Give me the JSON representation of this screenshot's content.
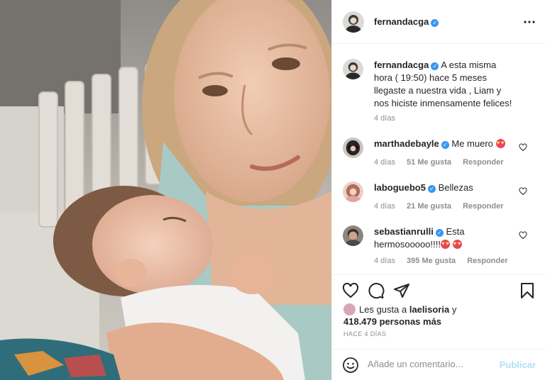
{
  "post": {
    "author": "fernandacga",
    "verified": true
  },
  "caption": {
    "username": "fernandacga",
    "text": "A esta misma hora ( 19:50) hace 5 meses llegaste a nuestra vida , Liam y nos hiciste inmensamente felices!",
    "time": "4 días"
  },
  "comments": [
    {
      "username": "marthadebayle",
      "verified": true,
      "text": "Me muero",
      "emoji": "heart-eyes-emoji",
      "time": "4 días",
      "likes": "51 Me gusta",
      "reply": "Responder"
    },
    {
      "username": "laboguebo5",
      "verified": true,
      "text": "Bellezas",
      "time": "4 días",
      "likes": "21 Me gusta",
      "reply": "Responder"
    },
    {
      "username": "sebastianrulli",
      "verified": true,
      "text": "Esta hermosooooo!!!!",
      "emoji": "heart-eyes-emoji",
      "time": "4 días",
      "likes": "395 Me gusta",
      "reply": "Responder"
    }
  ],
  "likes": {
    "prefix": "Les gusta a",
    "user": "laelisoria",
    "connector": "y",
    "count": "418.479 personas más"
  },
  "date": "HACE 4 DÍAS",
  "compose": {
    "placeholder": "Añade un comentario...",
    "post_label": "Publicar"
  },
  "icons": {
    "more": "more-options-icon",
    "like": "heart-icon",
    "comment": "comment-icon",
    "share": "share-icon",
    "save": "bookmark-icon",
    "emoji": "smiley-icon"
  },
  "colors": {
    "verified": "#3897f0",
    "post_button_disabled": "#b2dffc",
    "muted": "#8e8e8e"
  }
}
